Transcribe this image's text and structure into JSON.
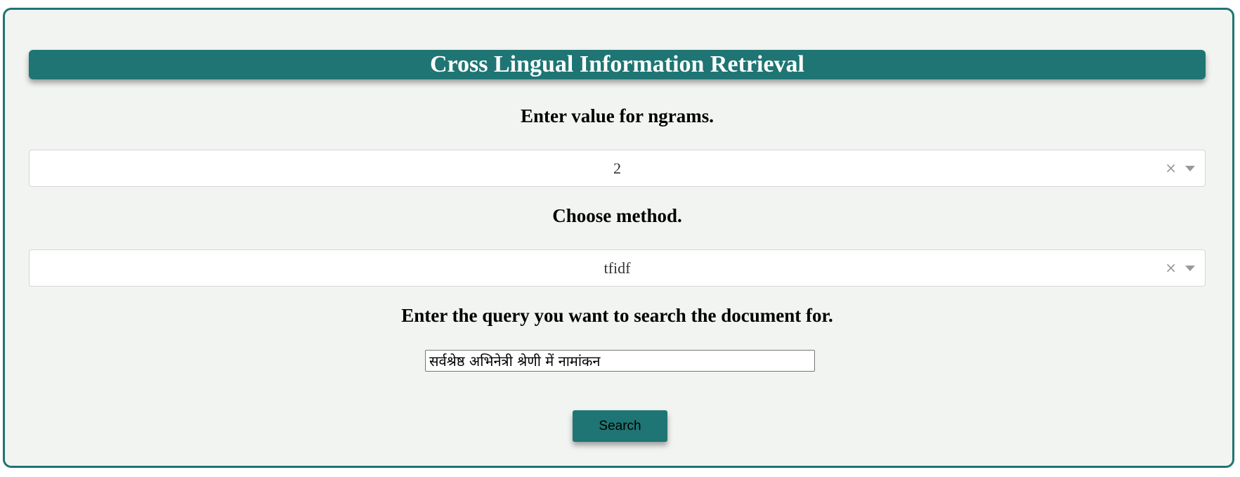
{
  "header": {
    "title": "Cross Lingual Information Retrieval"
  },
  "ngrams": {
    "label": "Enter value for ngrams.",
    "selected_value": "2",
    "clear_glyph": "×",
    "arrow_icon": "caret-down-icon"
  },
  "method": {
    "label": "Choose method.",
    "selected_value": "tfidf",
    "clear_glyph": "×",
    "arrow_icon": "caret-down-icon"
  },
  "query": {
    "label": "Enter the query you want to search the document for.",
    "value": "सर्वश्रेष्ठ अभिनेत्री श्रेणी में नामांकन"
  },
  "actions": {
    "search_label": "Search"
  },
  "colors": {
    "accent": "#1e7573",
    "panel_background": "#f2f4f2",
    "title_text": "#ffffff"
  }
}
